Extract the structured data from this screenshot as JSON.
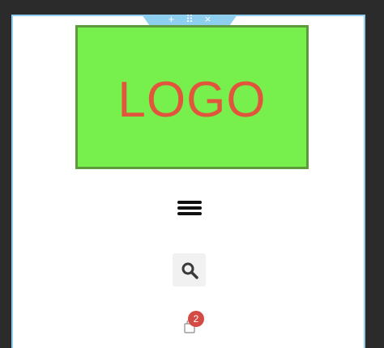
{
  "section_handle": {
    "icons": [
      "add-icon",
      "drag-grid-icon",
      "close-icon"
    ],
    "glyphs": [
      "+",
      "⠿",
      "×"
    ]
  },
  "logo": {
    "text": "LOGO"
  },
  "header": {
    "menu_toggle_icon": "hamburger-menu-icon",
    "search_icon": "search-icon",
    "cart_icon": "shopping-bag-icon",
    "cart_count": "2"
  },
  "colors": {
    "logo_background": "#77f04d",
    "logo_text": "#e2553d",
    "badge": "#d44a44",
    "section_outline": "#8ecff0"
  }
}
